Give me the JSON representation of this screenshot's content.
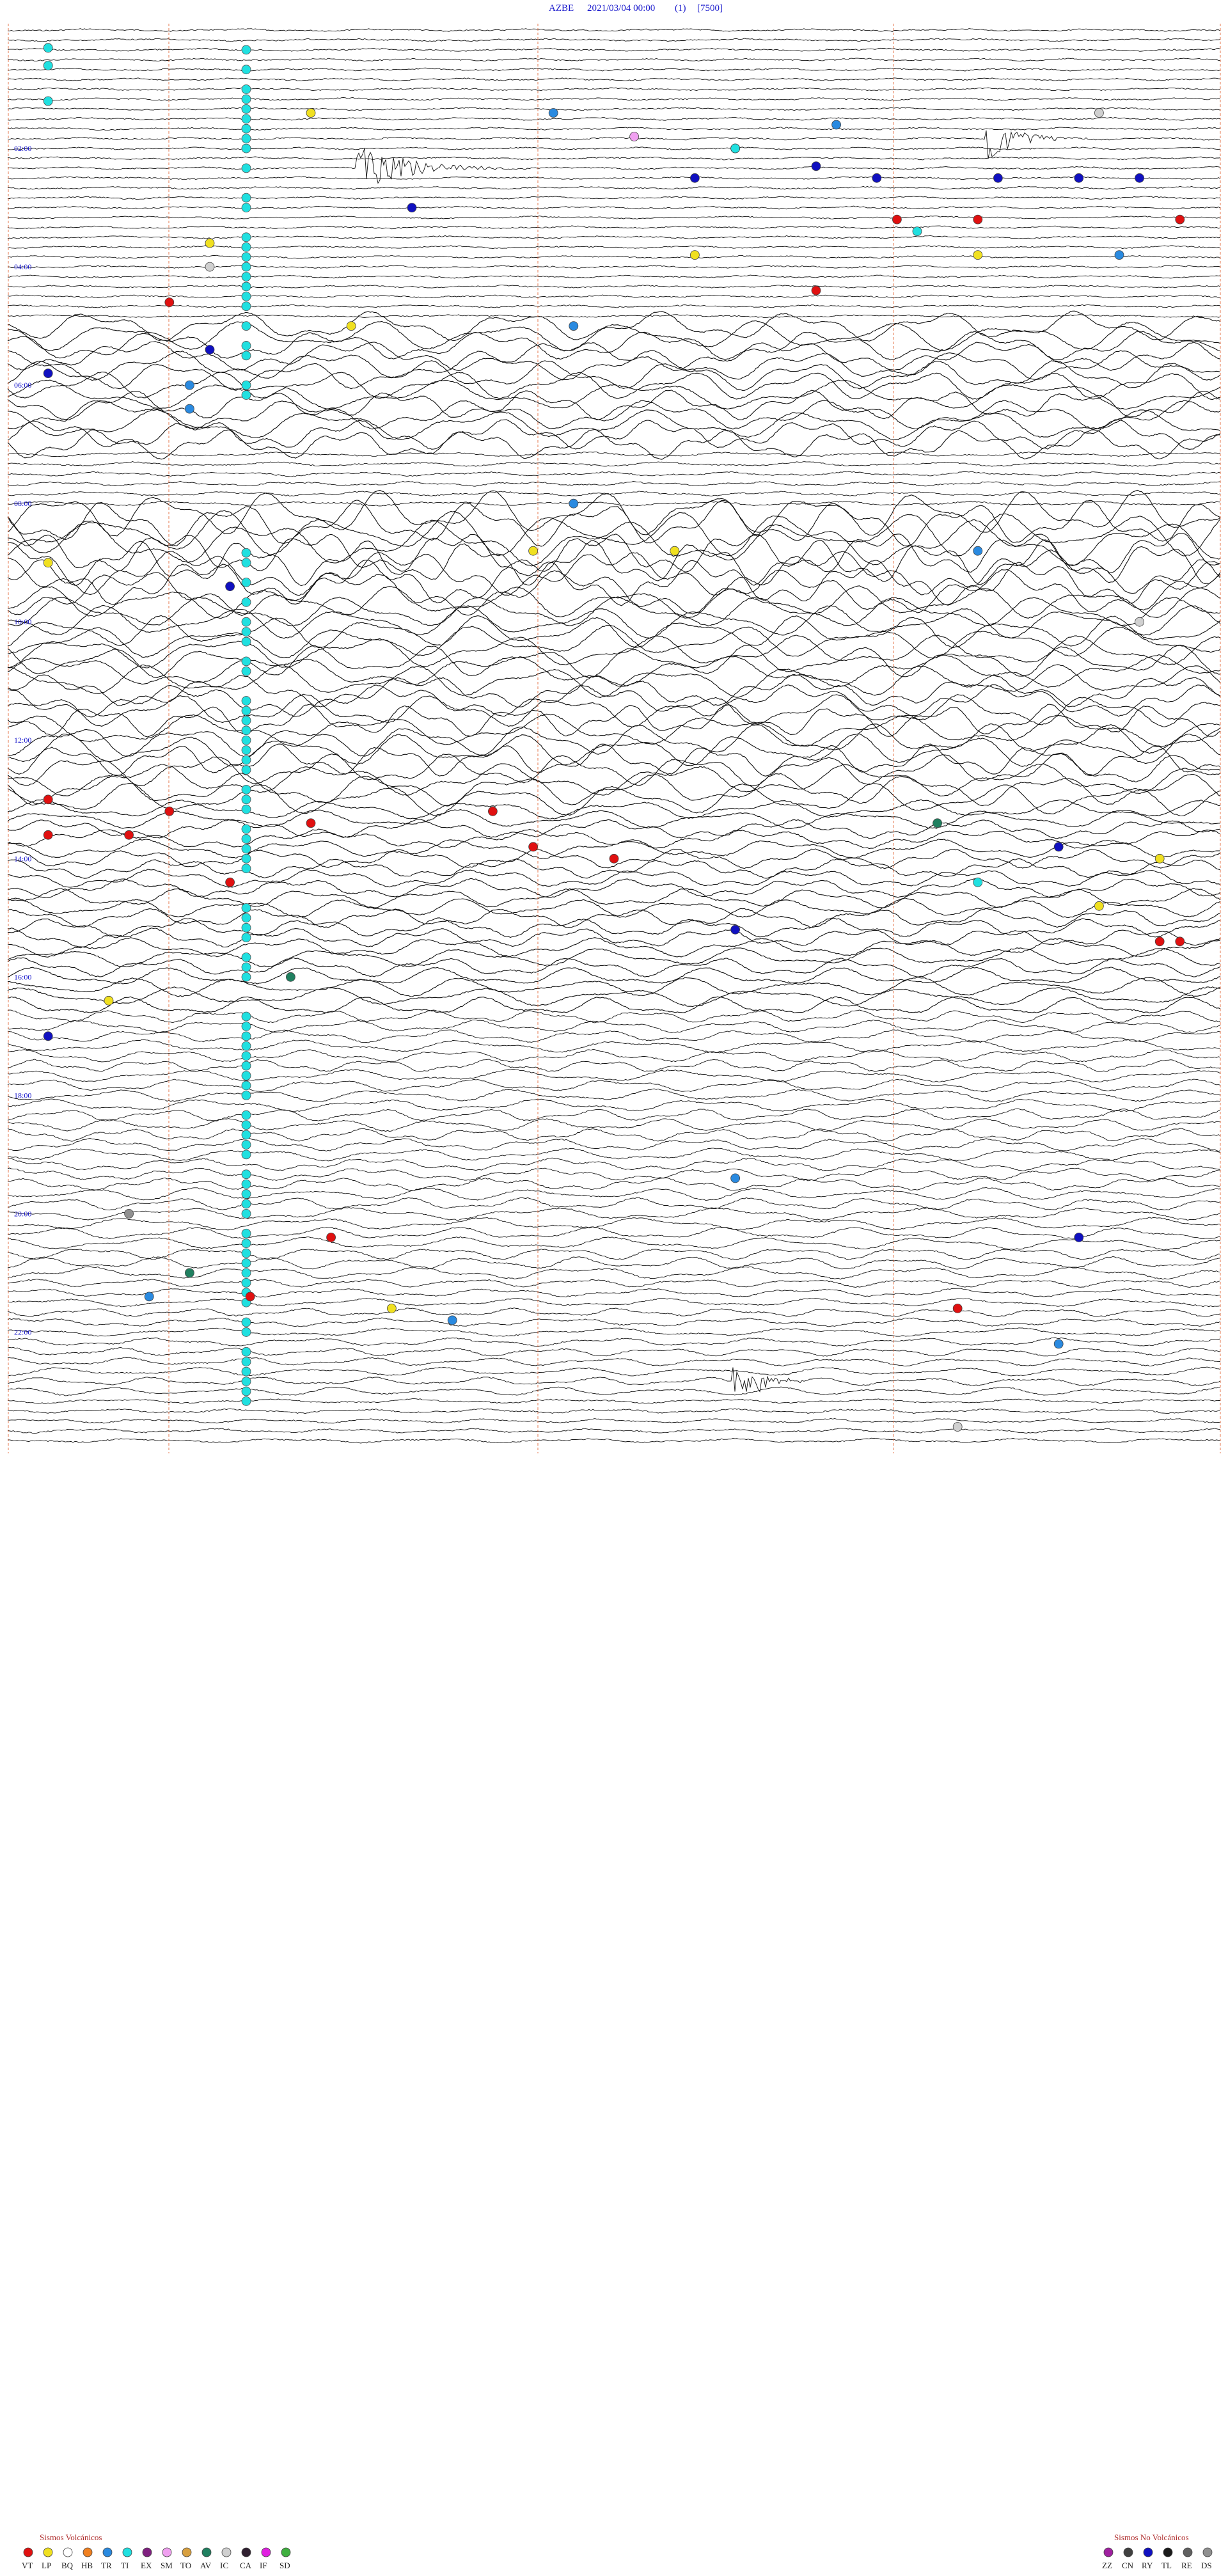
{
  "header": {
    "station": "AZBE",
    "datetime": "2021/03/04 00:00",
    "channel": "(1)",
    "scale": "[7500]"
  },
  "colors": {
    "trace": "#111111",
    "grid": "#e06030",
    "label": "#1a1acc",
    "legend_title": "#b03030"
  },
  "chart_data": {
    "type": "helicorder",
    "hour_labels": [
      "02:00",
      "04:00",
      "06:00",
      "08:00",
      "10:00",
      "12:00",
      "14:00",
      "16:00",
      "18:00",
      "20:00",
      "22:00"
    ],
    "grid": true,
    "events": [
      {
        "hour": 0.3,
        "minute": 2,
        "code": "TI"
      },
      {
        "hour": 0.6,
        "minute": 2,
        "code": "TI"
      },
      {
        "hour": 1.2,
        "minute": 2,
        "code": "TI"
      },
      {
        "hour": 1.4,
        "minute": 15,
        "code": "LP"
      },
      {
        "hour": 1.4,
        "minute": 27,
        "code": "TR"
      },
      {
        "hour": 1.4,
        "minute": 54,
        "code": "IC"
      },
      {
        "hour": 1.6,
        "minute": 41,
        "code": "TR"
      },
      {
        "hour": 1.8,
        "minute": 31,
        "code": "SM"
      },
      {
        "hour": 2.0,
        "minute": 36,
        "code": "HB"
      },
      {
        "hour": 2.0,
        "minute": 36,
        "code": "TI"
      },
      {
        "hour": 2.3,
        "minute": 40,
        "code": "RY"
      },
      {
        "hour": 2.5,
        "minute": 34,
        "code": "RY"
      },
      {
        "hour": 2.5,
        "minute": 43,
        "code": "RY"
      },
      {
        "hour": 2.5,
        "minute": 49,
        "code": "RY"
      },
      {
        "hour": 2.5,
        "minute": 53,
        "code": "RY"
      },
      {
        "hour": 2.5,
        "minute": 56,
        "code": "RY"
      },
      {
        "hour": 3.0,
        "minute": 20,
        "code": "RY"
      },
      {
        "hour": 3.2,
        "minute": 44,
        "code": "VT"
      },
      {
        "hour": 3.2,
        "minute": 48,
        "code": "VT"
      },
      {
        "hour": 3.2,
        "minute": 58,
        "code": "VT"
      },
      {
        "hour": 3.4,
        "minute": 45,
        "code": "TI"
      },
      {
        "hour": 3.6,
        "minute": 10,
        "code": "LP"
      },
      {
        "hour": 3.8,
        "minute": 34,
        "code": "LP"
      },
      {
        "hour": 3.8,
        "minute": 48,
        "code": "LP"
      },
      {
        "hour": 3.8,
        "minute": 55,
        "code": "TR"
      },
      {
        "hour": 4.0,
        "minute": 10,
        "code": "IC"
      },
      {
        "hour": 4.4,
        "minute": 40,
        "code": "VT"
      },
      {
        "hour": 4.6,
        "minute": 8,
        "code": "VT"
      },
      {
        "hour": 5.0,
        "minute": 17,
        "code": "LP"
      },
      {
        "hour": 5.0,
        "minute": 28,
        "code": "TR"
      },
      {
        "hour": 5.4,
        "minute": 10,
        "code": "RY"
      },
      {
        "hour": 5.8,
        "minute": 2,
        "code": "RY"
      },
      {
        "hour": 6.0,
        "minute": 9,
        "code": "TR"
      },
      {
        "hour": 6.4,
        "minute": 9,
        "code": "TR"
      },
      {
        "hour": 8.0,
        "minute": 28,
        "code": "TR"
      },
      {
        "hour": 8.8,
        "minute": 26,
        "code": "LP"
      },
      {
        "hour": 8.8,
        "minute": 33,
        "code": "LP"
      },
      {
        "hour": 8.8,
        "minute": 48,
        "code": "TR"
      },
      {
        "hour": 9.0,
        "minute": 2,
        "code": "LP"
      },
      {
        "hour": 9.4,
        "minute": 11,
        "code": "RY"
      },
      {
        "hour": 10.0,
        "minute": 56,
        "code": "IC"
      },
      {
        "hour": 13.0,
        "minute": 2,
        "code": "VT"
      },
      {
        "hour": 13.2,
        "minute": 8,
        "code": "VT"
      },
      {
        "hour": 13.2,
        "minute": 24,
        "code": "VT"
      },
      {
        "hour": 13.4,
        "minute": 15,
        "code": "VT"
      },
      {
        "hour": 13.4,
        "minute": 46,
        "code": "AV"
      },
      {
        "hour": 13.6,
        "minute": 2,
        "code": "VT"
      },
      {
        "hour": 13.6,
        "minute": 6,
        "code": "VT"
      },
      {
        "hour": 13.8,
        "minute": 26,
        "code": "VT"
      },
      {
        "hour": 13.8,
        "minute": 52,
        "code": "RY"
      },
      {
        "hour": 14.0,
        "minute": 30,
        "code": "VT"
      },
      {
        "hour": 14.0,
        "minute": 57,
        "code": "LP"
      },
      {
        "hour": 14.4,
        "minute": 11,
        "code": "VT"
      },
      {
        "hour": 14.4,
        "minute": 48,
        "code": "TI"
      },
      {
        "hour": 14.8,
        "minute": 54,
        "code": "LP"
      },
      {
        "hour": 15.2,
        "minute": 36,
        "code": "RY"
      },
      {
        "hour": 15.4,
        "minute": 57,
        "code": "VT"
      },
      {
        "hour": 15.4,
        "minute": 58,
        "code": "VT"
      },
      {
        "hour": 16.0,
        "minute": 14,
        "code": "AV"
      },
      {
        "hour": 16.4,
        "minute": 5,
        "code": "LP"
      },
      {
        "hour": 17.0,
        "minute": 2,
        "code": "RY"
      },
      {
        "hour": 19.4,
        "minute": 36,
        "code": "TR"
      },
      {
        "hour": 20.0,
        "minute": 6,
        "code": "DS"
      },
      {
        "hour": 20.4,
        "minute": 16,
        "code": "VT"
      },
      {
        "hour": 20.4,
        "minute": 53,
        "code": "RY"
      },
      {
        "hour": 21.0,
        "minute": 9,
        "code": "AV"
      },
      {
        "hour": 21.4,
        "minute": 7,
        "code": "TR"
      },
      {
        "hour": 21.4,
        "minute": 12,
        "code": "VT"
      },
      {
        "hour": 21.6,
        "minute": 19,
        "code": "LP"
      },
      {
        "hour": 21.6,
        "minute": 47,
        "code": "VT"
      },
      {
        "hour": 21.8,
        "minute": 22,
        "code": "TR"
      },
      {
        "hour": 22.2,
        "minute": 52,
        "code": "TR"
      },
      {
        "hour": 23.6,
        "minute": 47,
        "code": "IC"
      }
    ]
  },
  "legend": {
    "volcanic_title": "Sismos Volcánicos",
    "volcanic": [
      {
        "code": "VT",
        "color": "#e01010"
      },
      {
        "code": "LP",
        "color": "#f0e020"
      },
      {
        "code": "BQ",
        "color": "#ffffff"
      },
      {
        "code": "HB",
        "color": "#f08020"
      },
      {
        "code": "TR",
        "color": "#2a8ae0"
      },
      {
        "code": "TI",
        "color": "#20e0e0"
      },
      {
        "code": "EX",
        "color": "#802080"
      },
      {
        "code": "SM",
        "color": "#f0a0f0"
      },
      {
        "code": "TO",
        "color": "#d8a040"
      },
      {
        "code": "AV",
        "color": "#208060"
      },
      {
        "code": "IC",
        "color": "#d0d0d0"
      },
      {
        "code": "CA",
        "color": "#302030"
      },
      {
        "code": "IF",
        "color": "#e020e0"
      },
      {
        "code": "SD",
        "color": "#40b040"
      }
    ],
    "nonvolcanic_title": "Sismos No Volcánicos",
    "nonvolcanic": [
      {
        "code": "ZZ",
        "color": "#a020a0"
      },
      {
        "code": "CN",
        "color": "#404040"
      },
      {
        "code": "RY",
        "color": "#1010c0"
      },
      {
        "code": "TL",
        "color": "#1a1a1a"
      },
      {
        "code": "RE",
        "color": "#606060"
      },
      {
        "code": "DS",
        "color": "#909090"
      }
    ]
  }
}
